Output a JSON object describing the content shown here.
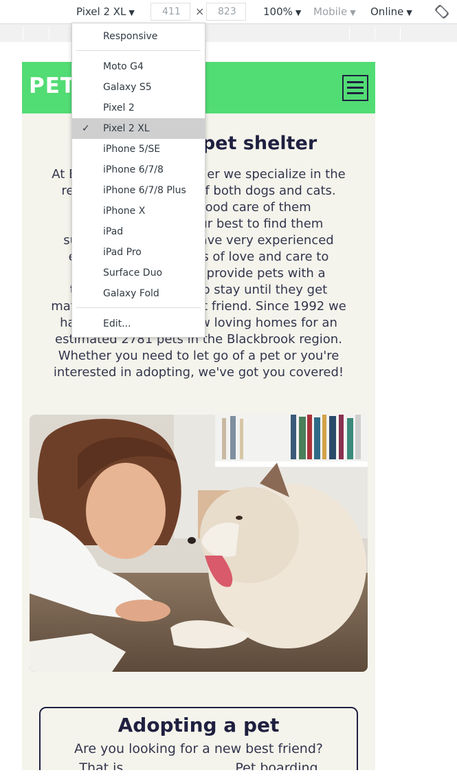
{
  "devtools": {
    "device_label": "Pixel 2 XL",
    "width_value": "411",
    "dim_separator": "×",
    "height_value": "823",
    "zoom_label": "100%",
    "mode_label": "Mobile",
    "network_label": "Online",
    "dropdown_arrow": "▼",
    "rotate_icon": "rotate-icon"
  },
  "device_menu": {
    "top_item": "Responsive",
    "devices": [
      "Moto G4",
      "Galaxy S5",
      "Pixel 2",
      "Pixel 2 XL",
      "iPhone 5/SE",
      "iPhone 6/7/8",
      "iPhone 6/7/8 Plus",
      "iPhone X",
      "iPad",
      "iPad Pro",
      "Surface Duo",
      "Galaxy Fold"
    ],
    "selected_index": 3,
    "check_mark": "✓",
    "edit_item": "Edit..."
  },
  "site": {
    "brand": "PET",
    "page_title_visible": "pet shelter",
    "intro_lines": [
      "At B                                 er we specialize in the",
      "resc                              f both dogs and cats.",
      "U                          good care of them",
      "imm                       our best to find them",
      "suitab                       have very experienced",
      "emp                       lots of love and care to",
      "our a                      to provide pets with a",
      "ter                            to stay until they get",
      "matc                             st friend. Since 1992 we",
      "have                          ew loving homes for an",
      "estimated 2781 pets in the Blackbrook region.",
      "Whether you need to let go of a pet or you're",
      "interested in adopting, we've got you covered!"
    ],
    "card_title": "Adopting a pet",
    "card_lines": [
      "Are you looking for a new best friend?",
      "That is                           Pet boarding"
    ]
  },
  "colors": {
    "header_green": "#52dc74",
    "page_background": "#f4f4ec",
    "navy": "#1f2040"
  }
}
